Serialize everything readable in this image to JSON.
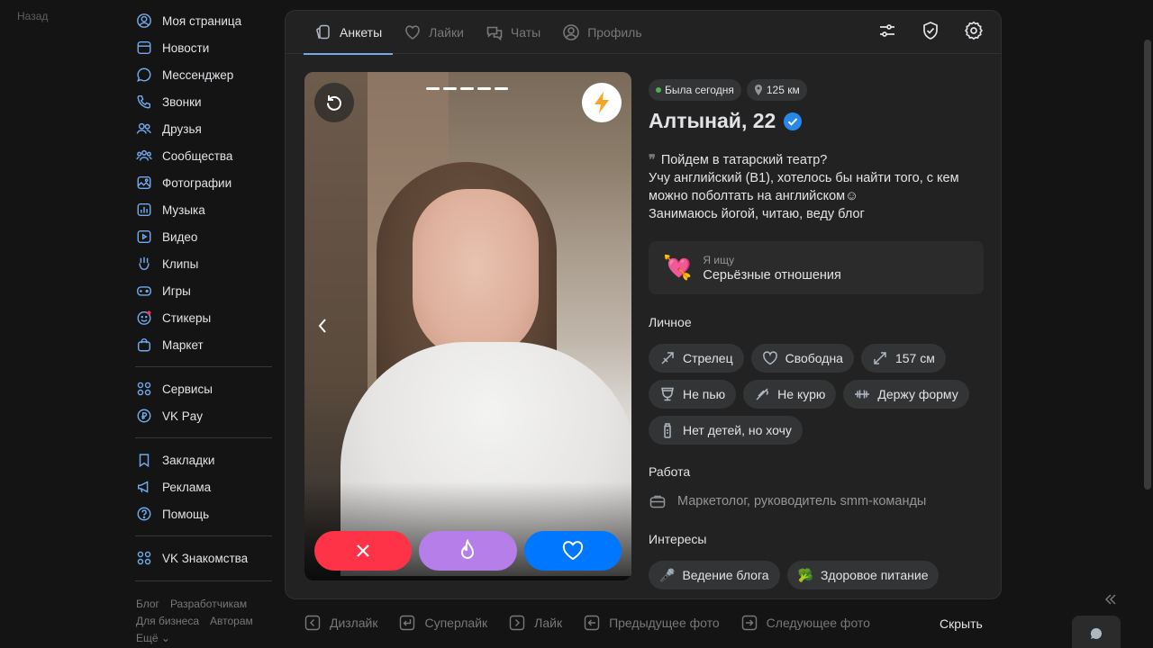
{
  "back_label": "Назад",
  "sidebar": {
    "items": [
      {
        "label": "Моя страница",
        "icon": "user-circle-icon"
      },
      {
        "label": "Новости",
        "icon": "news-icon"
      },
      {
        "label": "Мессенджер",
        "icon": "message-icon"
      },
      {
        "label": "Звонки",
        "icon": "phone-icon"
      },
      {
        "label": "Друзья",
        "icon": "friends-icon"
      },
      {
        "label": "Сообщества",
        "icon": "communities-icon"
      },
      {
        "label": "Фотографии",
        "icon": "photo-icon"
      },
      {
        "label": "Музыка",
        "icon": "music-icon"
      },
      {
        "label": "Видео",
        "icon": "video-icon"
      },
      {
        "label": "Клипы",
        "icon": "clips-icon"
      },
      {
        "label": "Игры",
        "icon": "gamepad-icon"
      },
      {
        "label": "Стикеры",
        "icon": "sticker-icon"
      },
      {
        "label": "Маркет",
        "icon": "bag-icon"
      }
    ],
    "group2": [
      {
        "label": "Сервисы",
        "icon": "services-icon"
      },
      {
        "label": "VK Pay",
        "icon": "ruble-icon"
      }
    ],
    "group3": [
      {
        "label": "Закладки",
        "icon": "bookmark-icon"
      },
      {
        "label": "Реклама",
        "icon": "megaphone-icon"
      },
      {
        "label": "Помощь",
        "icon": "help-icon"
      }
    ],
    "group4": [
      {
        "label": "VK Знакомства",
        "icon": "services-icon"
      }
    ],
    "footer": {
      "blog": "Блог",
      "devs": "Разработчикам",
      "business": "Для бизнеса",
      "authors": "Авторам",
      "more": "Ещё ⌄"
    }
  },
  "tabs": [
    {
      "label": "Анкеты",
      "icon": "cards-icon",
      "active": true
    },
    {
      "label": "Лайки",
      "icon": "heart-icon",
      "active": false
    },
    {
      "label": "Чаты",
      "icon": "chats-icon",
      "active": false
    },
    {
      "label": "Профиль",
      "icon": "profile-icon",
      "active": false
    }
  ],
  "profile": {
    "status": "Была сегодня",
    "distance": "125 км",
    "name": "Алтынай, 22",
    "bio_lines": [
      "Пойдем в татарский театр?",
      "Учу английский (B1), хотелось бы найти того, с кем",
      "можно поболтать на английском☺",
      "Занимаюсь йогой, читаю, веду блог"
    ],
    "goal_key": "Я ищу",
    "goal_value": "Серьёзные отношения",
    "personal_title": "Личное",
    "personal": [
      "Стрелец",
      "Свободна",
      "157 см",
      "Не пью",
      "Не курю",
      "Держу форму",
      "Нет детей, но хочу"
    ],
    "work_title": "Работа",
    "work": "Маркетолог, руководитель smm-команды",
    "interests_title": "Интересы",
    "interests": [
      "Ведение блога",
      "Здоровое питание"
    ],
    "photo_count": 5
  },
  "hotkeys": [
    {
      "label": "Дизлайк",
      "icon": "arrow-left-key-icon"
    },
    {
      "label": "Суперлайк",
      "icon": "enter-key-icon"
    },
    {
      "label": "Лайк",
      "icon": "arrow-right-key-icon"
    },
    {
      "label": "Предыдущее фото",
      "icon": "arrow-left-key-icon"
    },
    {
      "label": "Следующее фото",
      "icon": "arrow-right-key-icon"
    }
  ],
  "hide_label": "Скрыть",
  "colors": {
    "accent": "#71aaeb",
    "dislike": "#ff3347",
    "superlike": "#b67ee8",
    "like": "#0077ff",
    "online": "#4bb34b"
  }
}
